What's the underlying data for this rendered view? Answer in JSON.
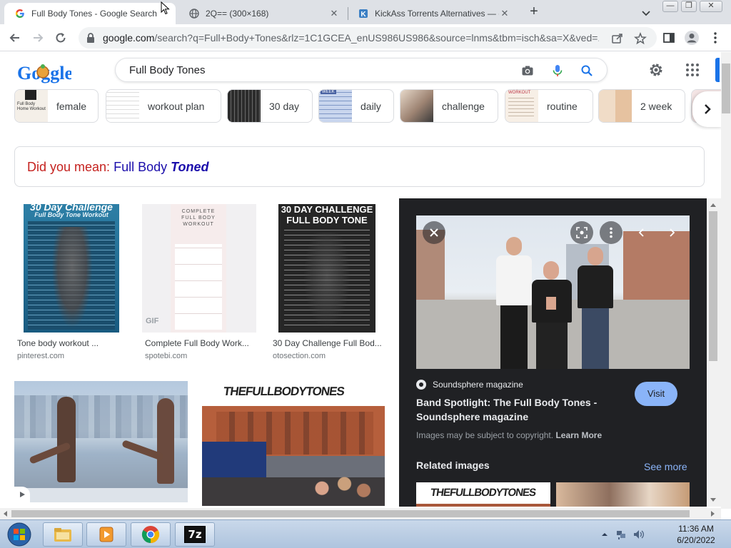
{
  "browser": {
    "tabs": [
      {
        "title": "Full Body Tones - Google Search",
        "active": true
      },
      {
        "title": "2Q== (300×168)",
        "active": false
      },
      {
        "title": "KickAss Torrents Alternatives — (",
        "active": false
      }
    ],
    "url_host": "google.com",
    "url_rest": "/search?q=Full+Body+Tones&rlz=1C1GCEA_enUS986US986&source=lnms&tbm=isch&sa=X&ved=..."
  },
  "google": {
    "logo_text": "Goggle",
    "query": "Full Body Tones",
    "chips": [
      {
        "label": "female",
        "thumb_text": "Full Body Home Workout"
      },
      {
        "label": "workout plan"
      },
      {
        "label": "30 day"
      },
      {
        "label": "daily",
        "thumb_text": "WEEK"
      },
      {
        "label": "challenge"
      },
      {
        "label": "routine",
        "thumb_text": "WORKOUT"
      },
      {
        "label": "2 week"
      }
    ],
    "did_you_mean": {
      "label": "Did you mean:",
      "prefix": "Full Body",
      "correction": "Toned"
    }
  },
  "results": [
    {
      "title": "Tone body workout ...",
      "source": "pinterest.com",
      "img_text": [
        "30 Day Challenge",
        "Full Body Tone Workout"
      ]
    },
    {
      "title": "Complete Full Body Work...",
      "source": "spotebi.com",
      "img_text": [
        "COMPLETE",
        "FULL BODY",
        "WORKOUT"
      ],
      "badge": "GIF"
    },
    {
      "title": "30 Day Challenge Full Bod...",
      "source": "otosection.com",
      "img_text": [
        "30 DAY CHALLENGE",
        "FULL BODY TONE"
      ]
    },
    {
      "title": "",
      "source": ""
    },
    {
      "title": "",
      "source": "",
      "img_text": [
        "THEFULLBODYTONES"
      ]
    }
  ],
  "panel": {
    "source": "Soundsphere magazine",
    "title": "Band Spotlight: The Full Body Tones - Soundsphere magazine",
    "visit": "Visit",
    "copyright": "Images may be subject to copyright.",
    "learn_more": "Learn More",
    "related": "Related images",
    "see_more": "See more",
    "thumb_text": "THEFULLBODYTONES"
  },
  "taskbar": {
    "time": "11:36 AM",
    "date": "6/20/2022",
    "app_7z": "7z"
  },
  "colors": {
    "google_blue": "#1a73e8",
    "panel_bg": "#202124",
    "visit_bg": "#8ab4f8"
  }
}
